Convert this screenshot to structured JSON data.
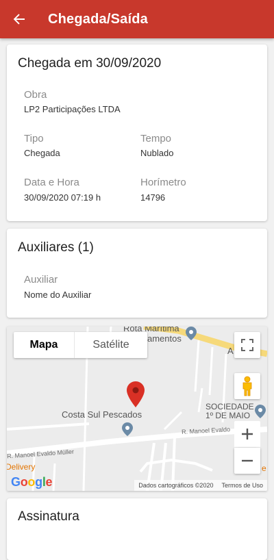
{
  "appbar": {
    "title": "Chegada/Saída",
    "back_icon": "arrow-back-icon"
  },
  "arrival_card": {
    "title": "Chegada em 30/09/2020",
    "fields": {
      "obra_label": "Obra",
      "obra_value": "LP2 Participações LTDA",
      "tipo_label": "Tipo",
      "tipo_value": "Chegada",
      "tempo_label": "Tempo",
      "tempo_value": "Nublado",
      "datahora_label": "Data e Hora",
      "datahora_value": "30/09/2020 07:19 h",
      "horimetro_label": "Horímetro",
      "horimetro_value": "14796"
    }
  },
  "auxiliares_card": {
    "title": "Auxiliares (1)",
    "auxiliar_label": "Auxiliar",
    "auxiliar_value": "Nome do Auxiliar"
  },
  "map": {
    "tab_map": "Mapa",
    "tab_satellite": "Satélite",
    "labels": {
      "rota_maritima": "Rota Marítima",
      "amentos": "amentos",
      "costa_sul": "Costa Sul Pescados",
      "sociedade_line1": "SOCIEDADE",
      "sociedade_line2": "1º DE MAIO",
      "street1": "R. Manoel Evaldo",
      "street2": "R. Manoel Evaldo Müller",
      "delivery": "Delivery",
      "a_partial": "A",
      "e_partial": "e"
    },
    "google": "Google",
    "footer_data": "Dados cartográficos ©2020",
    "footer_terms": "Termos de Uso",
    "pin_color": "#d93025"
  },
  "signature_card": {
    "title": "Assinatura"
  },
  "colors": {
    "primary": "#c8382c",
    "background": "#f1f1f1"
  }
}
